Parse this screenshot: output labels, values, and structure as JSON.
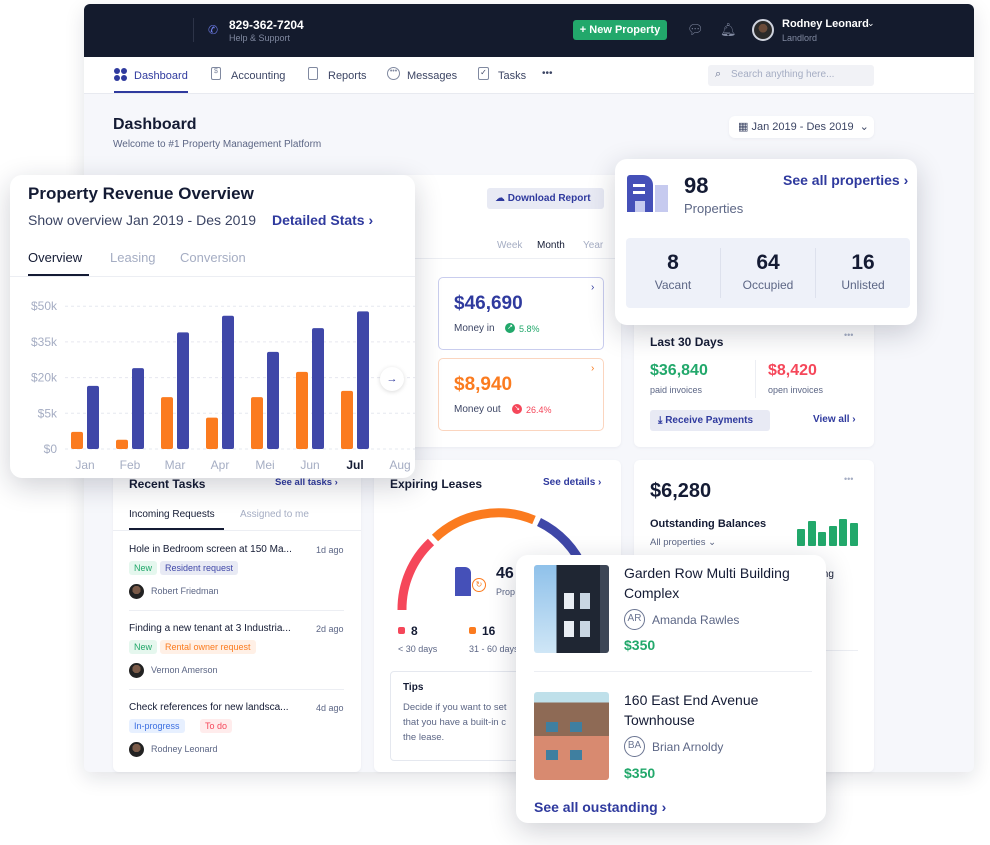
{
  "header": {
    "phone": "829-362-7204",
    "support": "Help & Support",
    "new_property": "+ New Property",
    "user_name": "Rodney Leonard",
    "user_role": "Landlord"
  },
  "nav": {
    "items": [
      {
        "label": "Dashboard",
        "icon": "dashboard-icon"
      },
      {
        "label": "Accounting",
        "icon": "accounting-icon"
      },
      {
        "label": "Reports",
        "icon": "reports-icon"
      },
      {
        "label": "Messages",
        "icon": "messages-icon"
      },
      {
        "label": "Tasks",
        "icon": "tasks-icon"
      }
    ],
    "more": "•••",
    "search_placeholder": "Search anything here..."
  },
  "page": {
    "title": "Dashboard",
    "subtitle": "Welcome to #1 Property Management Platform",
    "date_range": "Jan 2019 - Des 2019"
  },
  "revenue_card": {
    "download": "Download Report",
    "periods": [
      "Week",
      "Month",
      "Year"
    ],
    "active_period": "Month",
    "money_in": {
      "value": "$46,690",
      "label": "Money in",
      "change": "5.8%"
    },
    "money_out": {
      "value": "$8,940",
      "label": "Money out",
      "change": "26.4%"
    }
  },
  "properties": {
    "count": "98",
    "label": "Properties",
    "link": "See all properties ›",
    "stats": [
      {
        "value": "8",
        "label": "Vacant"
      },
      {
        "value": "64",
        "label": "Occupied"
      },
      {
        "value": "16",
        "label": "Unlisted"
      }
    ]
  },
  "last30": {
    "title": "Last 30 Days",
    "paid": "$36,840",
    "paid_label": "paid invoices",
    "open": "$8,420",
    "open_label": "open invoices",
    "receive": "Receive Payments",
    "view_all": "View all ›"
  },
  "revenue_popup": {
    "title": "Property Revenue Overview",
    "subtitle": "Show overview Jan 2019 - Des 2019",
    "link": "Detailed Stats ›",
    "tabs": [
      "Overview",
      "Leasing",
      "Conversion"
    ],
    "active_tab": "Overview"
  },
  "chart_data": {
    "type": "bar",
    "categories": [
      "Jan",
      "Feb",
      "Mar",
      "Apr",
      "Mei",
      "Jun",
      "Jul",
      "Aug"
    ],
    "highlight_category": "Jul",
    "y_ticks": [
      "$0",
      "$5k",
      "$20k",
      "$35k",
      "$50k"
    ],
    "y_tick_values": [
      0,
      5000,
      20000,
      35000,
      50000
    ],
    "grid": true,
    "series": [
      {
        "color": "#fb7b1f",
        "values": [
          2400,
          1300,
          11800,
          4400,
          11800,
          22400,
          14400,
          null
        ]
      },
      {
        "color": "#3f47a8",
        "values": [
          16500,
          24000,
          39000,
          46000,
          30800,
          40800,
          47800,
          null
        ]
      }
    ]
  },
  "tasks": {
    "title": "Recent Tasks",
    "link": "See all tasks ›",
    "tabs": [
      "Incoming Requests",
      "Assigned to me"
    ],
    "items": [
      {
        "title": "Hole in Bedroom screen at 150 Ma...",
        "time": "1d ago",
        "tags": [
          {
            "text": "New",
            "kind": "green"
          },
          {
            "text": "Resident request",
            "kind": "indigo"
          }
        ],
        "person": "Robert Friedman"
      },
      {
        "title": "Finding a new tenant at 3 Industria...",
        "time": "2d ago",
        "tags": [
          {
            "text": "New",
            "kind": "green"
          },
          {
            "text": "Rental owner request",
            "kind": "orange"
          }
        ],
        "person": "Vernon Amerson"
      },
      {
        "title": "Check references for new landsca...",
        "time": "4d ago",
        "tags": [
          {
            "text": "In-progress",
            "kind": "blue"
          },
          {
            "text": "To do",
            "kind": "red"
          }
        ],
        "person": "Rodney Leonard"
      }
    ]
  },
  "leases": {
    "title": "Expiring Leases",
    "link": "See details ›",
    "center_value": "46",
    "center_label": "Prop",
    "legend": [
      {
        "value": "8",
        "label": "< 30 days",
        "color": "#f5475a"
      },
      {
        "value": "16",
        "label": "31 - 60 days",
        "color": "#fb7b1f"
      }
    ],
    "tips_title": "Tips",
    "tips_lines": [
      "Decide if you want to set",
      "that you have a built-in c",
      "the lease."
    ]
  },
  "outstanding": {
    "value": "$6,280",
    "label": "Outstanding Balances",
    "filter": "All properties ⌄",
    "partial": "ding",
    "mini_bars": [
      0.62,
      0.88,
      0.5,
      0.72,
      0.95,
      0.82
    ]
  },
  "outstanding_popup": {
    "items": [
      {
        "title1": "Garden Row Multi Building",
        "title2": "Complex",
        "initials": "AR",
        "person": "Amanda Rawles",
        "amount": "$350"
      },
      {
        "title1": "160 East End Avenue",
        "title2": "Townhouse",
        "initials": "BA",
        "person": "Brian Arnoldy",
        "amount": "$350"
      }
    ],
    "link": "See all oustanding ›"
  },
  "colors": {
    "brand": "#2f3a9e",
    "green": "#22a86b",
    "orange": "#fb7b1f",
    "red": "#f5475a",
    "dark": "#141b2d"
  }
}
